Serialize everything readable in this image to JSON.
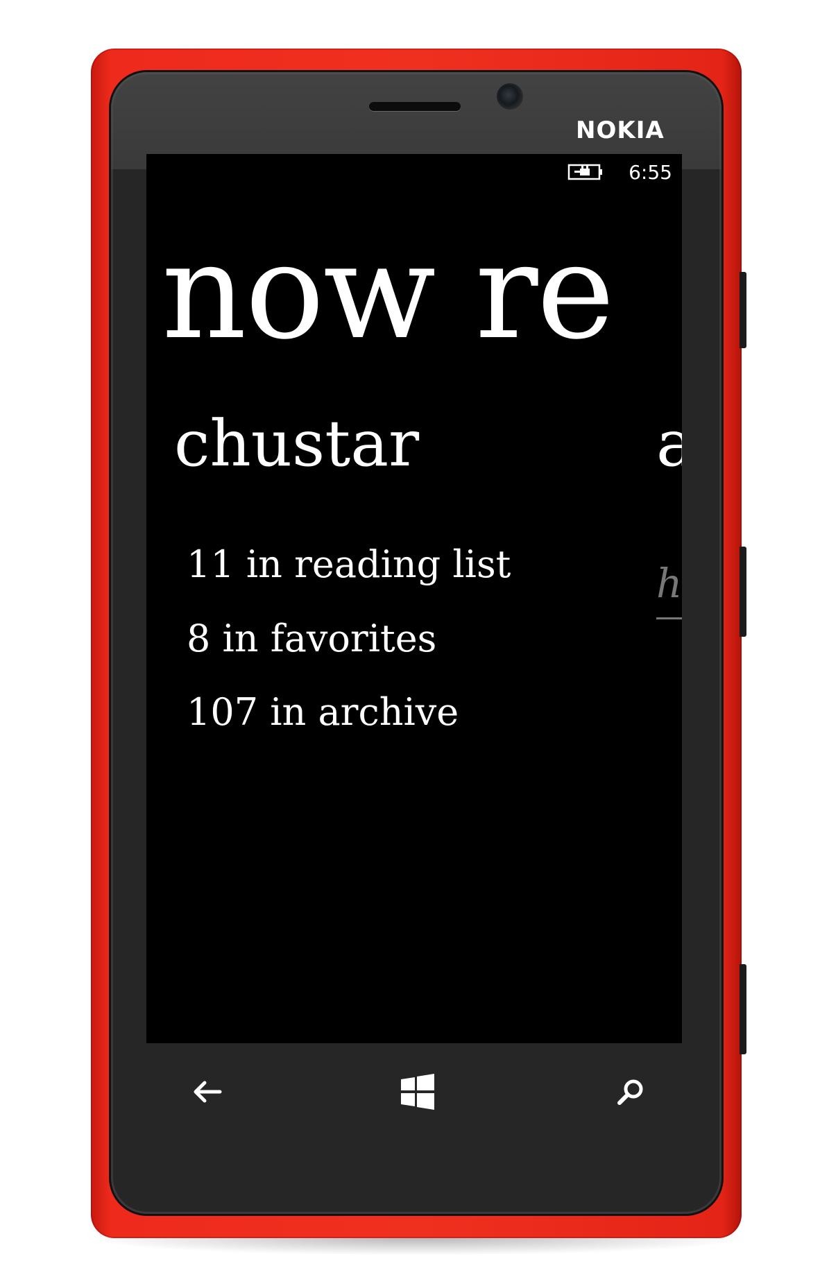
{
  "device": {
    "brand": "NOKIA",
    "body_color": "#ee2a1c"
  },
  "status_bar": {
    "battery_icon": "battery-charging-icon",
    "time": "6:55"
  },
  "panorama": {
    "title": "now re",
    "current_section": {
      "title": "chustar",
      "stats": [
        {
          "text": "11 in reading list"
        },
        {
          "text": "8 in favorites"
        },
        {
          "text": "107 in archive"
        }
      ]
    },
    "next_section_peek": {
      "title": "a",
      "link_peek": "h"
    }
  },
  "nav_bar": {
    "back": "back-arrow-icon",
    "start": "windows-logo-icon",
    "search": "search-icon"
  }
}
